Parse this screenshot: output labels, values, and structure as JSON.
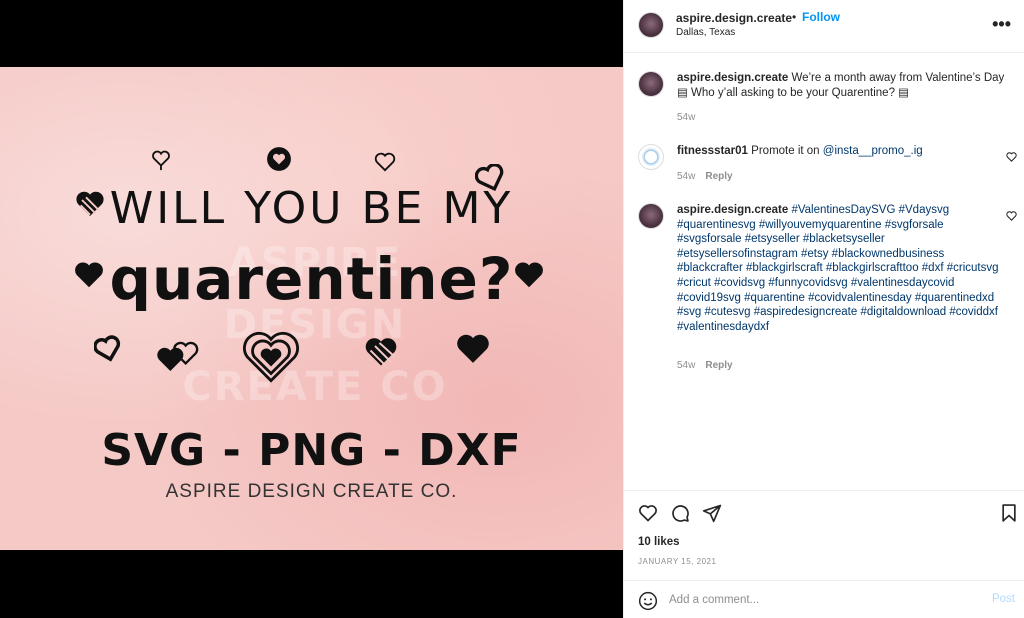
{
  "media": {
    "watermark": "ASPIRE DESIGN CREATE CO",
    "line1": "WILL YOU BE MY",
    "line2": "quarentine?",
    "formats": "SVG - PNG - DXF",
    "brand": "ASPIRE DESIGN CREATE CO."
  },
  "header": {
    "username": "aspire.design.create",
    "dot": "•",
    "follow_label": "Follow",
    "location": "Dallas, Texas",
    "more_label": "•••"
  },
  "caption": {
    "username": "aspire.design.create",
    "text": "We’re a month away from Valentine’s Day ▤ Who y’all asking to be your Quarentine? ▤",
    "time": "54w"
  },
  "comment1": {
    "username": "fitnessstar01",
    "text_prefix": "Promote it on ",
    "mention": "@insta__promo_.ig",
    "time": "54w",
    "reply_label": "Reply"
  },
  "comment2": {
    "username": "aspire.design.create",
    "hashtags": "#ValentinesDaySVG #Vdaysvg #quarentinesvg #willyouvemyquarentine #svgforsale #svgsforsale #etsyseller #blacketsyseller #etsysellersofinstagram #etsy #blackownedbusiness #blackcrafter #blackgirlscraft #blackgirlscrafttoo #dxf #cricutsvg #cricut #covidsvg #funnycovidsvg #valentinesdaycovid #covid19svg #quarentine #covidvalentinesday #quarentinedxd #svg #cutesvg #aspiredesigncreate #digitaldownload #coviddxf #valentinesdaydxf",
    "time": "54w",
    "reply_label": "Reply"
  },
  "engagement": {
    "likes": "10 likes",
    "date": "JANUARY 15, 2021"
  },
  "comment_box": {
    "placeholder": "Add a comment...",
    "post_label": "Post"
  }
}
